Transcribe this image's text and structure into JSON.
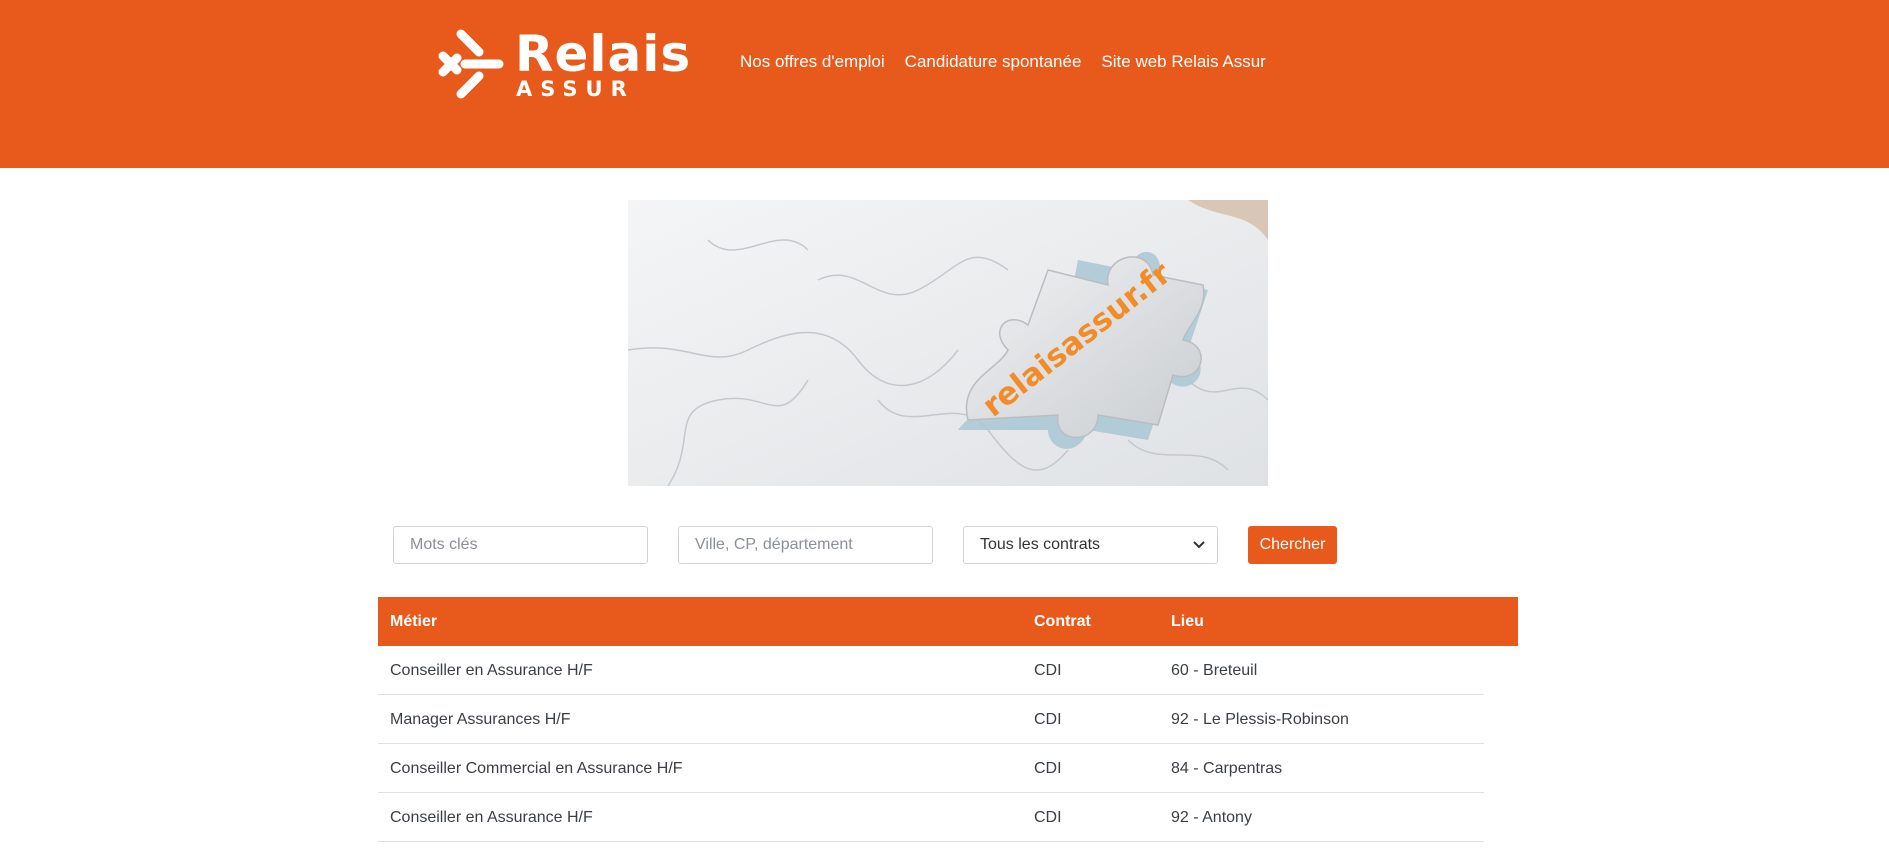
{
  "brand": {
    "logo_word": "Relais",
    "logo_sub": "ASSUR",
    "color": "#e8591c"
  },
  "nav": {
    "items": [
      {
        "label": "Nos offres d'emploi"
      },
      {
        "label": "Candidature spontanée"
      },
      {
        "label": "Site web Relais Assur"
      }
    ]
  },
  "hero": {
    "piece_text": "relaisassur.fr",
    "text_color": "#f28c28"
  },
  "search": {
    "keywords_placeholder": "Mots clés",
    "location_placeholder": "Ville, CP, département",
    "contract_selected": "Tous les contrats",
    "button_label": "Chercher"
  },
  "table": {
    "headers": {
      "job": "Métier",
      "contract": "Contrat",
      "location": "Lieu"
    },
    "rows": [
      {
        "job": "Conseiller en Assurance H/F",
        "contract": "CDI",
        "location": "60 - Breteuil"
      },
      {
        "job": "Manager Assurances H/F",
        "contract": "CDI",
        "location": "92 - Le Plessis-Robinson"
      },
      {
        "job": "Conseiller Commercial en Assurance H/F",
        "contract": "CDI",
        "location": "84 - Carpentras"
      },
      {
        "job": "Conseiller en Assurance H/F",
        "contract": "CDI",
        "location": "92 - Antony"
      }
    ]
  }
}
